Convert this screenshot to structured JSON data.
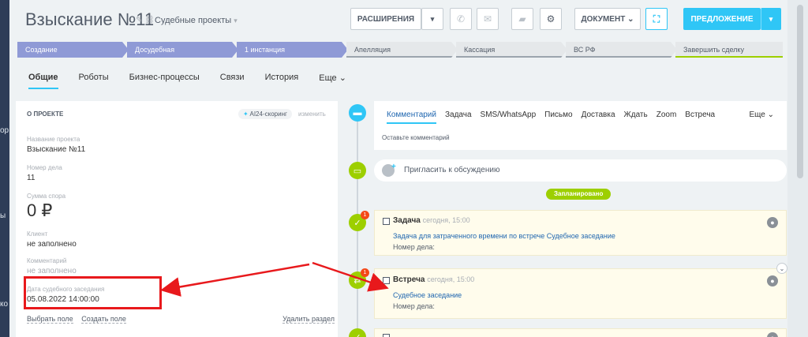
{
  "background_strip": {
    "labels": [
      "ор",
      "ы",
      "ко"
    ]
  },
  "header": {
    "title": "Взыскание №11",
    "project_link": "Судебные проекты",
    "extensions_label": "РАСШИРЕНИЯ",
    "document_label": "ДОКУМЕНТ",
    "offer_label": "ПРЕДЛОЖЕНИЕ"
  },
  "stages": [
    {
      "label": "Создание",
      "state": "done"
    },
    {
      "label": "Досудебная",
      "state": "done"
    },
    {
      "label": "1 инстанция",
      "state": "done"
    },
    {
      "label": "Апелляция",
      "state": "todo"
    },
    {
      "label": "Кассация",
      "state": "todo"
    },
    {
      "label": "ВС РФ",
      "state": "todo"
    },
    {
      "label": "Завершить сделку",
      "state": "final"
    }
  ],
  "tabs": [
    "Общие",
    "Роботы",
    "Бизнес-процессы",
    "Связи",
    "История",
    "Еще"
  ],
  "about": {
    "header": "О ПРОЕКТЕ",
    "scoring_label": "AI24-скоринг",
    "edit_label": "изменить",
    "fields": [
      {
        "label": "Название проекта",
        "value": "Взыскание №11"
      },
      {
        "label": "Номер дела",
        "value": "11"
      },
      {
        "label": "Сумма спора",
        "value": "0 ₽"
      },
      {
        "label": "Клиент",
        "value": "не заполнено"
      },
      {
        "label": "Комментарий",
        "value": "не заполнено"
      },
      {
        "label": "Дата судебного заседания",
        "value": "05.08.2022 14:00:00"
      }
    ],
    "select_field": "Выбрать поле",
    "create_field": "Создать поле",
    "delete_section": "Удалить раздел"
  },
  "composer": {
    "tabs": [
      "Комментарий",
      "Задача",
      "SMS/WhatsApp",
      "Письмо",
      "Доставка",
      "Ждать",
      "Zoom",
      "Встреча"
    ],
    "more": "Еще",
    "placeholder": "Оставьте комментарий"
  },
  "invite_text": "Пригласить к обсуждению",
  "planned_label": "Запланировано",
  "activities": [
    {
      "type": "Задача",
      "time": "сегодня, 15:00",
      "link": "Задача для затраченного времени по встрече Судебное заседание",
      "meta": "Номер дела:",
      "badge": "1"
    },
    {
      "type": "Встреча",
      "time": "сегодня, 15:00",
      "link": "Судебное заседание",
      "meta": "Номер дела:",
      "badge": "1"
    }
  ],
  "colors": {
    "accent": "#2fc6f6",
    "stage_done": "#8f9ad6",
    "timeline_green": "#9dcf00",
    "annotation_red": "#e8191c"
  }
}
